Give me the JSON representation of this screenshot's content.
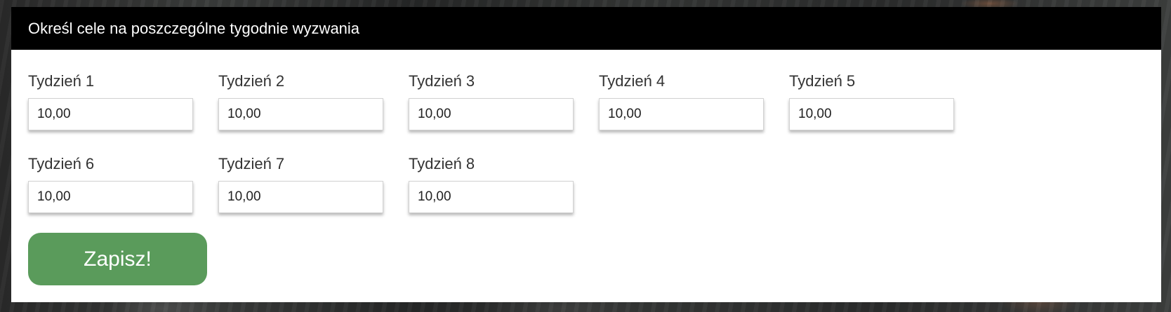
{
  "panel": {
    "title": "Określ cele na poszczególne tygodnie wyzwania",
    "weeks": [
      {
        "label": "Tydzień 1",
        "value": "10,00"
      },
      {
        "label": "Tydzień 2",
        "value": "10,00"
      },
      {
        "label": "Tydzień 3",
        "value": "10,00"
      },
      {
        "label": "Tydzień 4",
        "value": "10,00"
      },
      {
        "label": "Tydzień 5",
        "value": "10,00"
      },
      {
        "label": "Tydzień 6",
        "value": "10,00"
      },
      {
        "label": "Tydzień 7",
        "value": "10,00"
      },
      {
        "label": "Tydzień 8",
        "value": "10,00"
      }
    ],
    "save_label": "Zapisz!"
  },
  "colors": {
    "header_bg": "#000000",
    "panel_bg": "#ffffff",
    "save_button": "#5a9b5b"
  }
}
